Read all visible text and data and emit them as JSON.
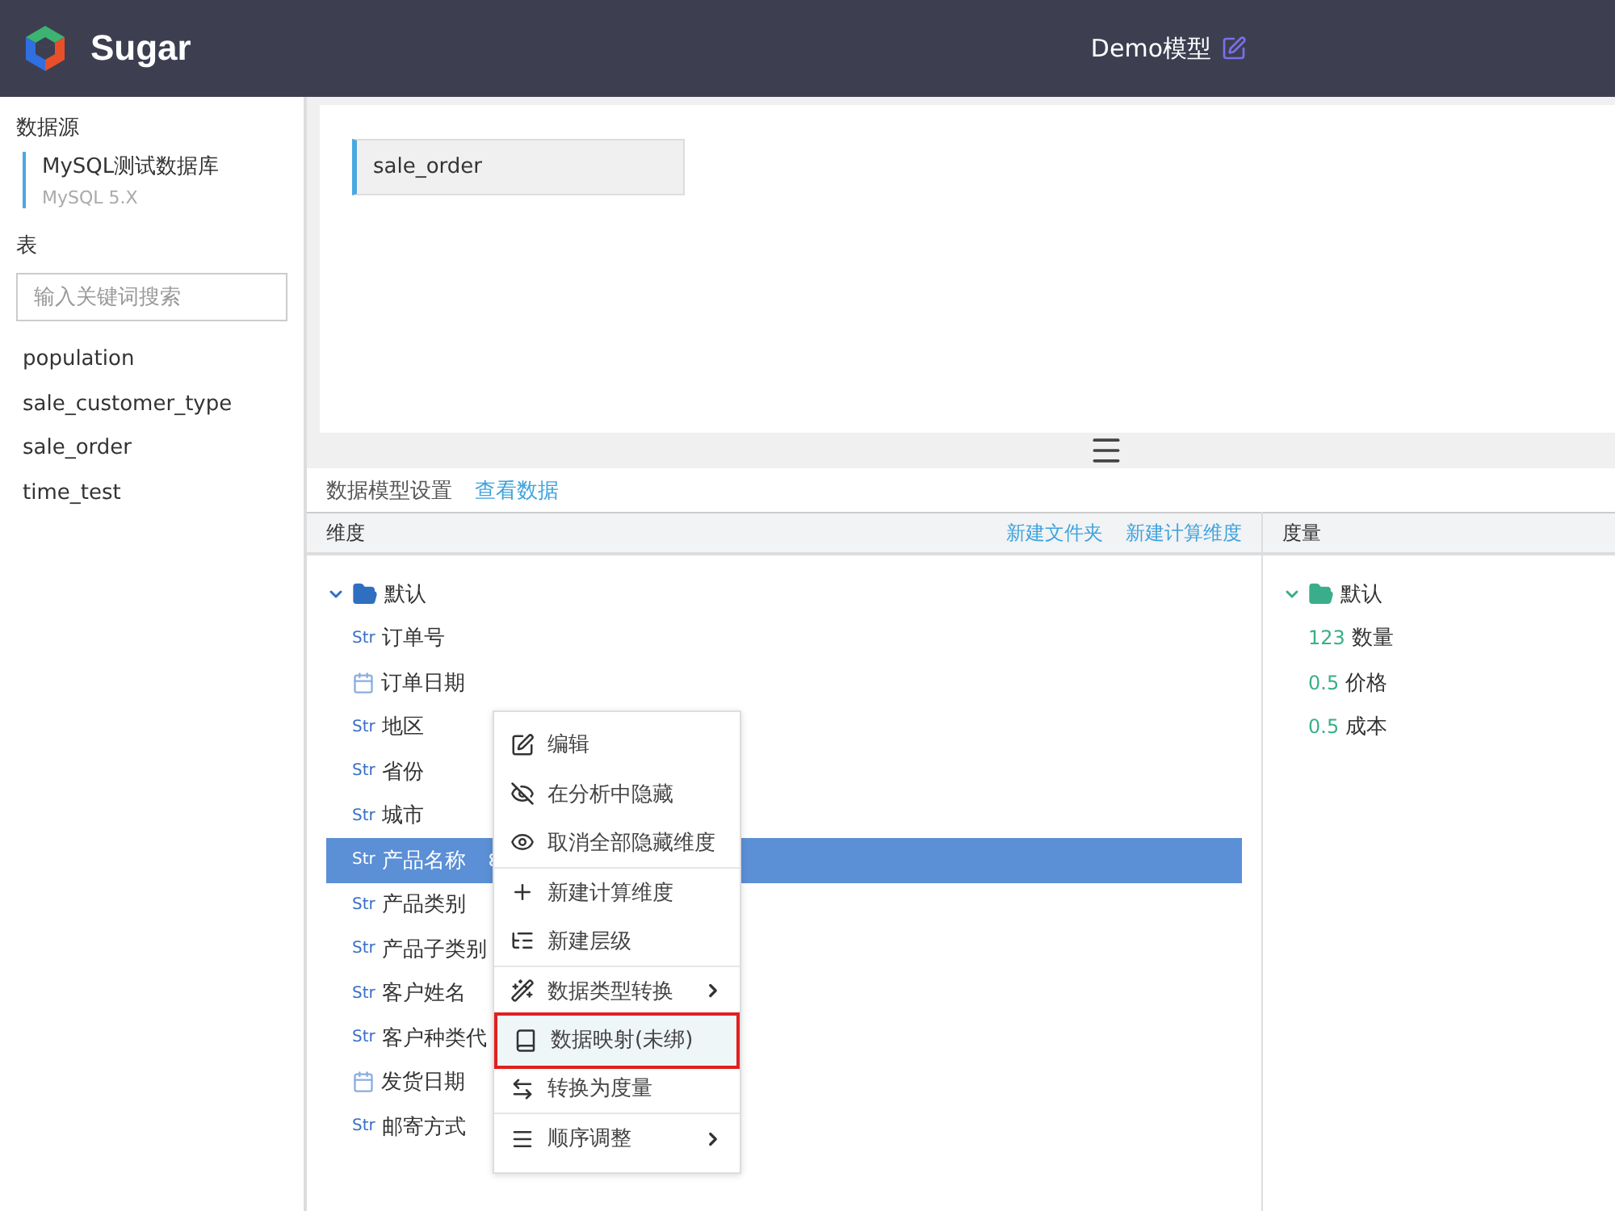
{
  "header": {
    "brand": "Sugar",
    "title": "Demo模型"
  },
  "sidebar": {
    "source_heading": "数据源",
    "source": {
      "name": "MySQL测试数据库",
      "version": "MySQL 5.X"
    },
    "tables_heading": "表",
    "search": {
      "placeholder": "输入关键词搜索"
    },
    "tables": [
      "population",
      "sale_customer_type",
      "sale_order",
      "time_test"
    ]
  },
  "canvas": {
    "tables": [
      {
        "name": "sale_order"
      }
    ]
  },
  "tabs": [
    {
      "label": "数据模型设置",
      "selected": true
    },
    {
      "label": "查看数据",
      "selected": false
    }
  ],
  "dimensions": {
    "heading": "维度",
    "actions": [
      "新建文件夹",
      "新建计算维度"
    ],
    "folder": {
      "name": "默认",
      "expanded": true
    },
    "fields": [
      {
        "kind": "str",
        "type_label": "Str",
        "name": "订单号",
        "selected": false
      },
      {
        "kind": "date",
        "name": "订单日期",
        "selected": false
      },
      {
        "kind": "str",
        "type_label": "Str",
        "name": "地区",
        "selected": false
      },
      {
        "kind": "str",
        "type_label": "Str",
        "name": "省份",
        "selected": false
      },
      {
        "kind": "str",
        "type_label": "Str",
        "name": "城市",
        "selected": false
      },
      {
        "kind": "str",
        "type_label": "Str",
        "name": "产品名称",
        "selected": true
      },
      {
        "kind": "str",
        "type_label": "Str",
        "name": "产品类别",
        "selected": false
      },
      {
        "kind": "str",
        "type_label": "Str",
        "name": "产品子类别",
        "selected": false
      },
      {
        "kind": "str",
        "type_label": "Str",
        "name": "客户姓名",
        "selected": false
      },
      {
        "kind": "str",
        "type_label": "Str",
        "name": "客户种类代",
        "selected": false
      },
      {
        "kind": "date",
        "name": "发货日期",
        "selected": false
      },
      {
        "kind": "str",
        "type_label": "Str",
        "name": "邮寄方式",
        "selected": false
      }
    ]
  },
  "measures": {
    "heading": "度量",
    "folder": {
      "name": "默认",
      "expanded": true
    },
    "fields": [
      {
        "type_label": "123",
        "name": "数量"
      },
      {
        "type_label": "0.5",
        "name": "价格"
      },
      {
        "type_label": "0.5",
        "name": "成本"
      }
    ]
  },
  "context_menu": {
    "items": [
      {
        "kind": "edit",
        "label": "编辑",
        "submenu": false,
        "highlighted": false,
        "divider_after": false
      },
      {
        "kind": "hide",
        "label": "在分析中隐藏",
        "submenu": false,
        "highlighted": false,
        "divider_after": false
      },
      {
        "kind": "show",
        "label": "取消全部隐藏维度",
        "submenu": false,
        "highlighted": false,
        "divider_after": true
      },
      {
        "kind": "add",
        "label": "新建计算维度",
        "submenu": false,
        "highlighted": false,
        "divider_after": false
      },
      {
        "kind": "hierarchy",
        "label": "新建层级",
        "submenu": false,
        "highlighted": false,
        "divider_after": true
      },
      {
        "kind": "convert",
        "label": "数据类型转换",
        "submenu": true,
        "highlighted": false,
        "divider_after": false
      },
      {
        "kind": "mapping",
        "label": "数据映射(未绑)",
        "submenu": false,
        "highlighted": true,
        "divider_after": false
      },
      {
        "kind": "swap",
        "label": "转换为度量",
        "submenu": false,
        "highlighted": false,
        "divider_after": true
      },
      {
        "kind": "order",
        "label": "顺序调整",
        "submenu": true,
        "highlighted": false,
        "divider_after": false
      }
    ]
  }
}
